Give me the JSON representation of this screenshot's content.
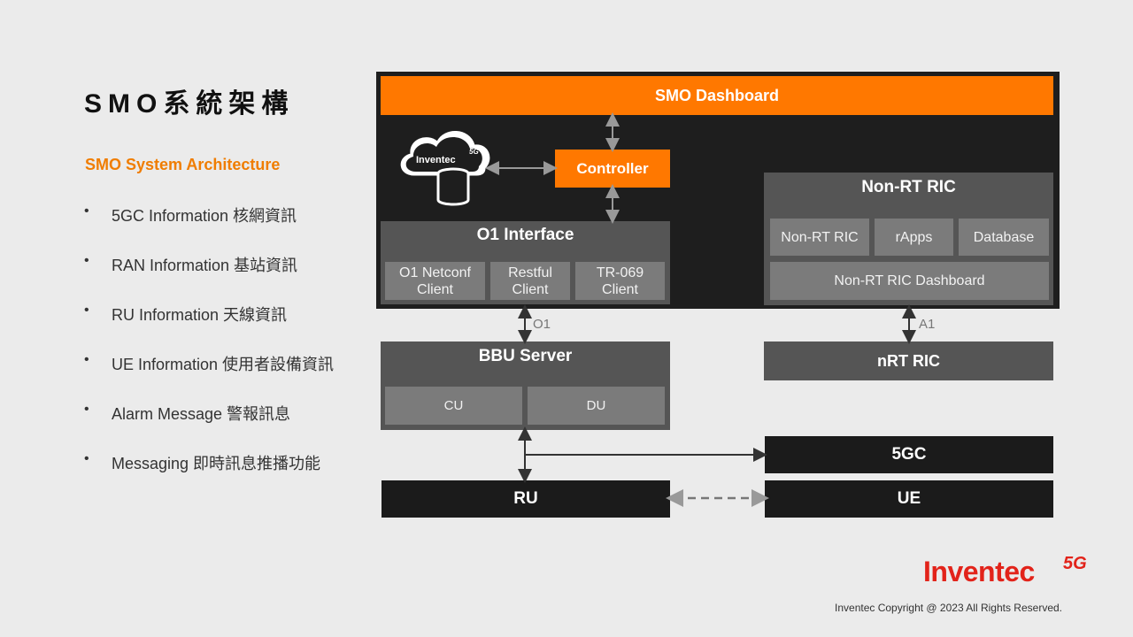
{
  "title": "SMO系統架構",
  "subtitle": "SMO System Architecture",
  "bullets": [
    "5GC Information 核網資訊",
    "RAN Information 基站資訊",
    "RU Information 天線資訊",
    "UE Information 使用者設備資訊",
    "Alarm Message 警報訊息",
    "Messaging 即時訊息推播功能"
  ],
  "diagram": {
    "smo_dashboard": "SMO Dashboard",
    "cloud_label": "Inventec",
    "cloud_badge": "5G",
    "controller": "Controller",
    "o1_interface": {
      "title": "O1 Interface",
      "items": [
        {
          "line1": "O1 Netconf",
          "line2": "Client"
        },
        {
          "line1": "Restful",
          "line2": "Client"
        },
        {
          "line1": "TR-069",
          "line2": "Client"
        }
      ]
    },
    "non_rt_ric": {
      "title": "Non-RT RIC",
      "items": [
        "Non-RT RIC",
        "rApps",
        "Database"
      ],
      "dashboard": "Non-RT RIC Dashboard"
    },
    "o1_label": "O1",
    "a1_label": "A1",
    "bbu": {
      "title": "BBU Server",
      "items": [
        "CU",
        "DU"
      ]
    },
    "nrt_ric": "nRT RIC",
    "fivegc": "5GC",
    "ru": "RU",
    "ue": "UE"
  },
  "footer": {
    "logo_text": "Inventec",
    "logo_badge": "5G",
    "copyright": "Inventec Copyright @ 2023 All Rights Reserved."
  },
  "colors": {
    "accent": "#ff7800",
    "dark_frame": "#1e1e1e",
    "box_gray": "#555555",
    "sub_gray": "#7b7b7b",
    "logo_red": "#e2231a"
  }
}
